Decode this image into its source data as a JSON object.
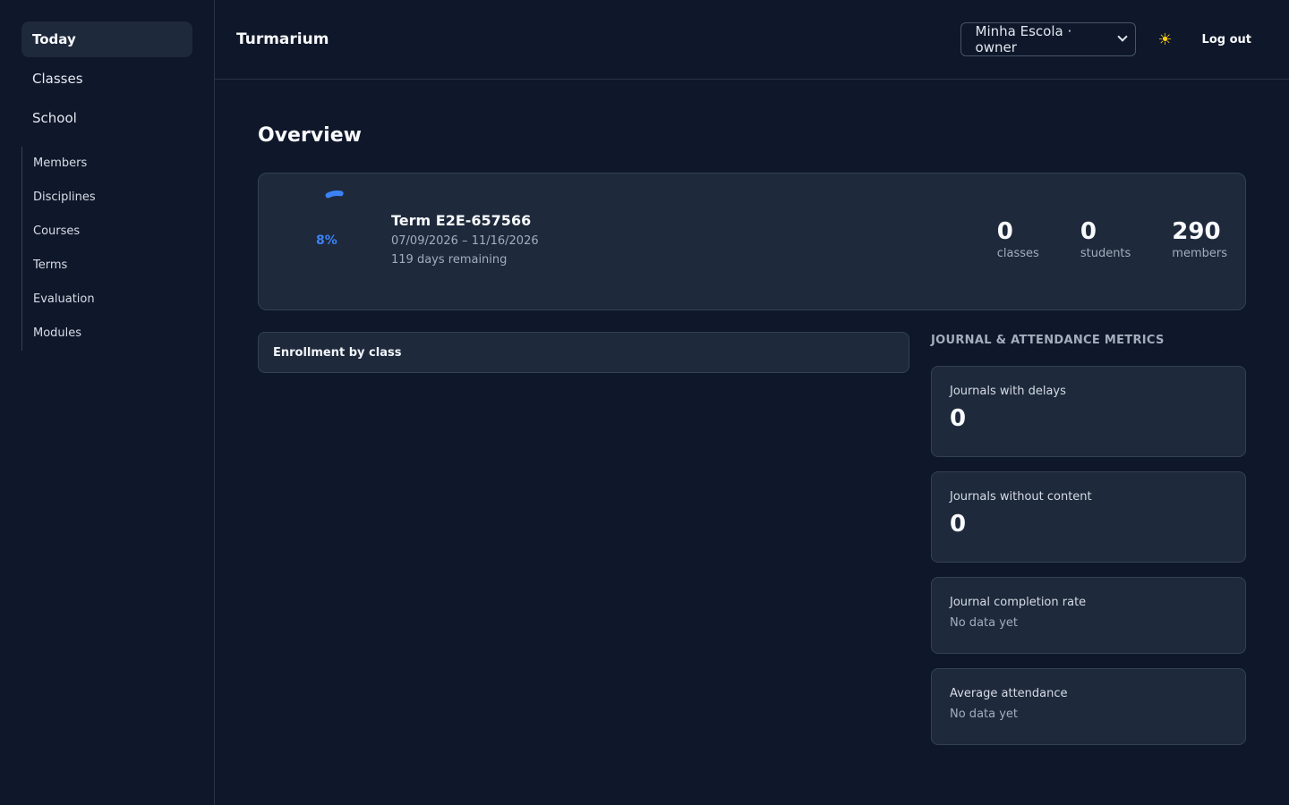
{
  "sidebar": {
    "items": [
      {
        "label": "Today"
      },
      {
        "label": "Classes"
      },
      {
        "label": "School"
      }
    ],
    "school_subitems": [
      {
        "label": "Members"
      },
      {
        "label": "Disciplines"
      },
      {
        "label": "Courses"
      },
      {
        "label": "Terms"
      },
      {
        "label": "Evaluation"
      },
      {
        "label": "Modules"
      }
    ]
  },
  "header": {
    "brand": "Turmarium",
    "school_select": "Minha Escola · owner",
    "theme_icon": "sun-icon",
    "logout_label": "Log out"
  },
  "main": {
    "title": "Overview",
    "term": {
      "name": "Term E2E-657566",
      "dates": "07/09/2026 – 11/16/2026",
      "remaining": "119 days remaining",
      "progress_label": "8%",
      "progress": 0.08
    },
    "stats": [
      {
        "value": "0",
        "label": "classes"
      },
      {
        "value": "0",
        "label": "students"
      },
      {
        "value": "290",
        "label": "members"
      }
    ],
    "enrollment_title": "Enrollment by class",
    "metrics_heading": "JOURNAL & ATTENDANCE METRICS",
    "metrics": [
      {
        "label": "Journals with delays",
        "value": "0"
      },
      {
        "label": "Journals without content",
        "value": "0"
      },
      {
        "label": "Journal completion rate",
        "note": "No data yet"
      },
      {
        "label": "Average attendance",
        "note": "No data yet"
      }
    ]
  },
  "colors": {
    "background": "#0f172a",
    "card": "#1e293b",
    "accent": "#3b82f6"
  }
}
